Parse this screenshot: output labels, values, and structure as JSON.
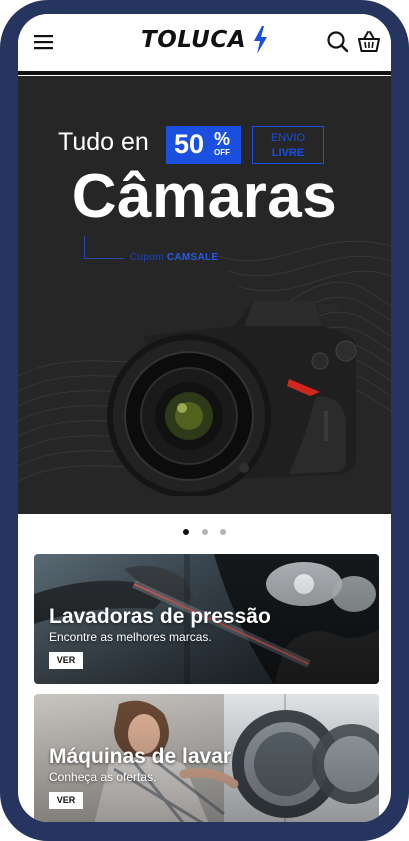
{
  "header": {
    "logo_text": "TOLUCA",
    "icons": {
      "menu": "hamburger-menu-icon",
      "logo": "lightning-bolt-icon",
      "search": "search-icon",
      "cart": "shopping-basket-icon"
    }
  },
  "hero": {
    "line1": "Tudo en",
    "discount_number": "50",
    "discount_percent": "%",
    "discount_off": "OFF",
    "shipping_line1": "ENVIO",
    "shipping_line2": "LIVRE",
    "title": "Câmaras",
    "coupon_label": "Cupom",
    "coupon_code": "CAMSALE",
    "image": "dslr-camera"
  },
  "carousel": {
    "total": 3,
    "active": 1
  },
  "cards": [
    {
      "title": "Lavadoras de pressão",
      "subtitle": "Encontre as melhores marcas.",
      "button": "VER",
      "image": "pressure-washer-car"
    },
    {
      "title": "Máquinas de lavar",
      "subtitle": "Conheça as ofertas.",
      "button": "VER",
      "image": "washing-machine-woman"
    }
  ],
  "colors": {
    "accent": "#1a4fe0",
    "frame": "#26355f",
    "hero_bg": "#262626"
  }
}
